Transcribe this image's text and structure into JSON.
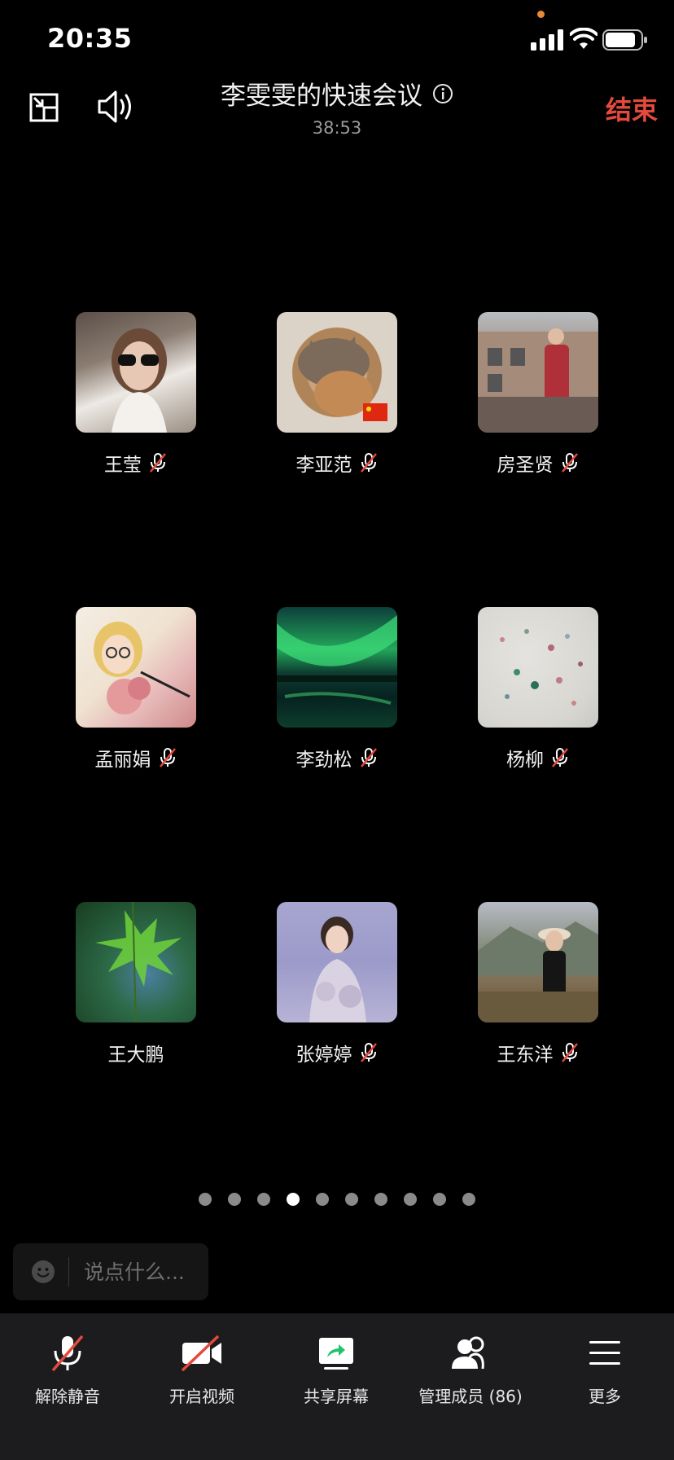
{
  "status_bar": {
    "time": "20:35"
  },
  "header": {
    "title": "李雯雯的快速会议",
    "timer": "38:53",
    "end_label": "结束"
  },
  "participants": [
    {
      "name": "王莹",
      "muted": true
    },
    {
      "name": "李亚范",
      "muted": true
    },
    {
      "name": "房圣贤",
      "muted": true
    },
    {
      "name": "孟丽娟",
      "muted": true
    },
    {
      "name": "李劲松",
      "muted": true
    },
    {
      "name": "杨柳",
      "muted": true
    },
    {
      "name": "王大鹏",
      "muted": false
    },
    {
      "name": "张婷婷",
      "muted": true
    },
    {
      "name": "王东洋",
      "muted": true
    }
  ],
  "pagination": {
    "pages": 10,
    "current": 4
  },
  "chat": {
    "placeholder": "说点什么..."
  },
  "toolbar": {
    "unmute_label": "解除静音",
    "video_label": "开启视频",
    "share_label": "共享屏幕",
    "members_label": "管理成员 (86)",
    "more_label": "更多"
  },
  "colors": {
    "end": "#e4493d",
    "accent_share": "#1fc36b",
    "muted_slash": "#e4493d"
  }
}
